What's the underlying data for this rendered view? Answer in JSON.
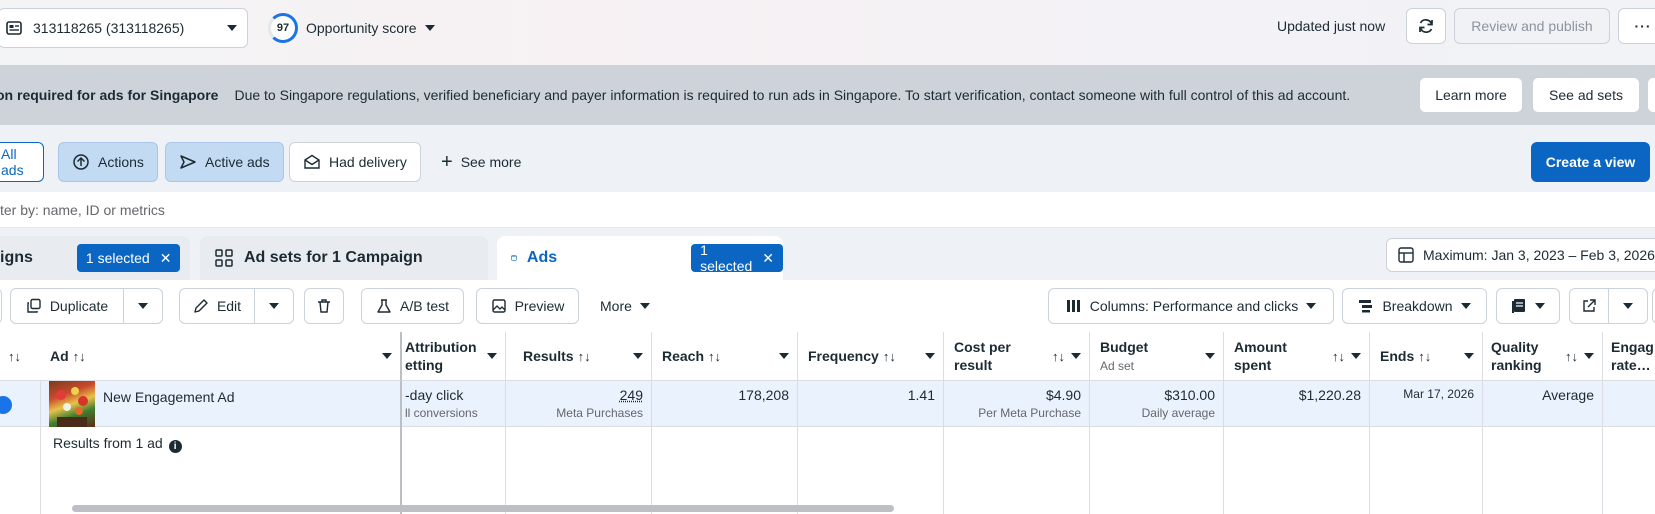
{
  "header": {
    "account_label": "313118265 (313118265)",
    "opportunity_score": "97",
    "opportunity_label": "Opportunity score",
    "updated": "Updated just now",
    "review_label": "Review and publish",
    "more_icon": "ellipsis-icon"
  },
  "banner": {
    "title": "on required for ads for Singapore",
    "message": "Due to Singapore regulations, verified beneficiary and payer information is required to run ads in Singapore. To start verification, contact someone with full control of this ad account.",
    "learn_more": "Learn more",
    "see_ad_sets": "See ad sets"
  },
  "filters": {
    "all_ads": "All ads",
    "actions": "Actions",
    "active_ads": "Active ads",
    "had_delivery": "Had delivery",
    "see_more": "See more",
    "create_view": "Create a view"
  },
  "search": {
    "placeholder": "ter by: name, ID or metrics"
  },
  "tabs": {
    "campaigns": "igns",
    "campaigns_selected": "1 selected",
    "adsets": "Ad sets for 1 Campaign",
    "ads": "Ads",
    "ads_selected": "1 selected",
    "date_range": "Maximum: Jan 3, 2023 – Feb 3, 2026"
  },
  "toolbar": {
    "duplicate": "Duplicate",
    "edit": "Edit",
    "ab_test": "A/B test",
    "preview": "Preview",
    "more": "More",
    "columns": "Columns: Performance and clicks",
    "breakdown": "Breakdown"
  },
  "table": {
    "headers": {
      "ad": "Ad",
      "attribution_l1": "Attribution",
      "attribution_l2": "etting",
      "results": "Results",
      "reach": "Reach",
      "frequency": "Frequency",
      "cost_l1": "Cost per",
      "cost_l2": "result",
      "budget": "Budget",
      "budget_sub": "Ad set",
      "amount_l1": "Amount",
      "amount_l2": "spent",
      "ends": "Ends",
      "quality_l1": "Quality",
      "quality_l2": "ranking",
      "engage_l1": "Engag",
      "engage_l2": "rate…"
    },
    "row": {
      "ad_name": "New Engagement Ad",
      "attribution": "-day click",
      "attribution_sub": "ll conversions",
      "results": "249",
      "results_sub": "Meta Purchases",
      "reach": "178,208",
      "frequency": "1.41",
      "cost": "$4.90",
      "cost_sub": "Per Meta Purchase",
      "budget": "$310.00",
      "budget_sub": "Daily average",
      "amount": "$1,220.28",
      "ends": "Mar 17, 2026",
      "quality": "Average"
    },
    "summary": "Results from 1 ad"
  },
  "colors": {
    "primary": "#0a66c2",
    "selected_chip": "#c3daf3",
    "banner": "#cdd3d9",
    "row_highlight": "#eaf2fd"
  }
}
